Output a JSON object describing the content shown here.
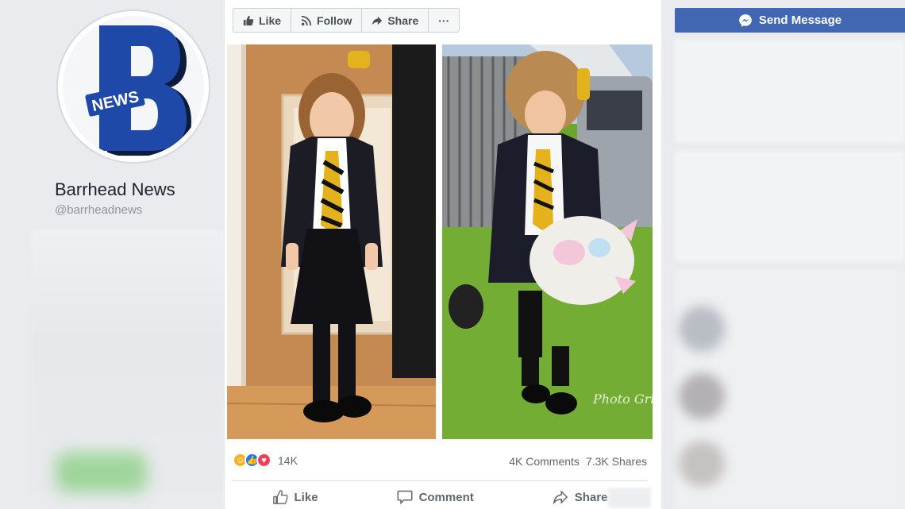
{
  "page": {
    "name": "Barrhead News",
    "handle": "@barrheadnews",
    "logo_letter": "B",
    "logo_badge": "NEWS"
  },
  "post_actions": {
    "like": "Like",
    "follow": "Follow",
    "share": "Share",
    "more": "···"
  },
  "post": {
    "photo_watermark": "Photo Grid",
    "reaction_count": "14K",
    "comments": "4K Comments",
    "shares": "7.3K Shares",
    "bottom": {
      "like": "Like",
      "comment": "Comment",
      "share": "Share"
    }
  },
  "sidebar": {
    "send_message": "Send Message"
  },
  "colors": {
    "brand_blue": "#4267b2",
    "logo_blue": "#1f49a8",
    "haha": "#f7b125",
    "like": "#1877f2",
    "love": "#f33e58"
  },
  "icons": {
    "like": "thumbs-up-icon",
    "follow": "rss-icon",
    "share": "share-arrow-icon",
    "messenger": "messenger-icon",
    "comment": "speech-bubble-icon"
  }
}
